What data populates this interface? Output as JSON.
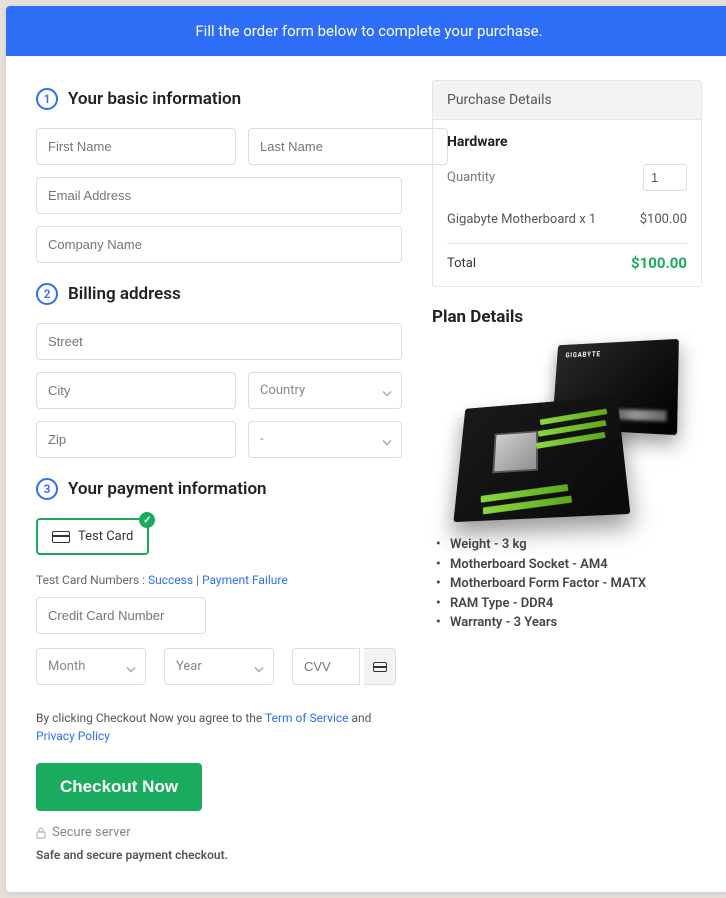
{
  "banner": "Fill the order form below to complete your purchase.",
  "sections": {
    "s1": {
      "num": "1",
      "title": "Your basic information"
    },
    "s2": {
      "num": "2",
      "title": "Billing address"
    },
    "s3": {
      "num": "3",
      "title": "Your payment information"
    }
  },
  "fields": {
    "first_name": "First Name",
    "last_name": "Last Name",
    "email": "Email Address",
    "company": "Company Name",
    "street": "Street",
    "city": "City",
    "country": "Country",
    "zip": "Zip",
    "state": "-",
    "credit_card": "Credit Card Number",
    "month": "Month",
    "year": "Year",
    "cvv": "CVV"
  },
  "card_option": "Test Card",
  "test_numbers": {
    "prefix": "Test Card Numbers : ",
    "success": "Success",
    "sep": " | ",
    "failure": "Payment Failure"
  },
  "terms": {
    "prefix": "By clicking Checkout Now you agree to the ",
    "tos": "Term of Service",
    "and": " and ",
    "pp": "Privacy Policy"
  },
  "checkout_btn": "Checkout Now",
  "secure": "Secure server",
  "safe": "Safe and secure payment checkout.",
  "purchase": {
    "panel_title": "Purchase Details",
    "category": "Hardware",
    "qty_label": "Quantity",
    "qty_value": "1",
    "item_desc": "Gigabyte Motherboard x 1",
    "item_price": "$100.00",
    "total_label": "Total",
    "total_value": "$100.00"
  },
  "plan": {
    "title": "Plan Details",
    "bullets": [
      "Weight - 3 kg",
      "Motherboard Socket - AM4",
      "Motherboard Form Factor - MATX",
      "RAM Type - DDR4",
      "Warranty - 3 Years"
    ]
  }
}
